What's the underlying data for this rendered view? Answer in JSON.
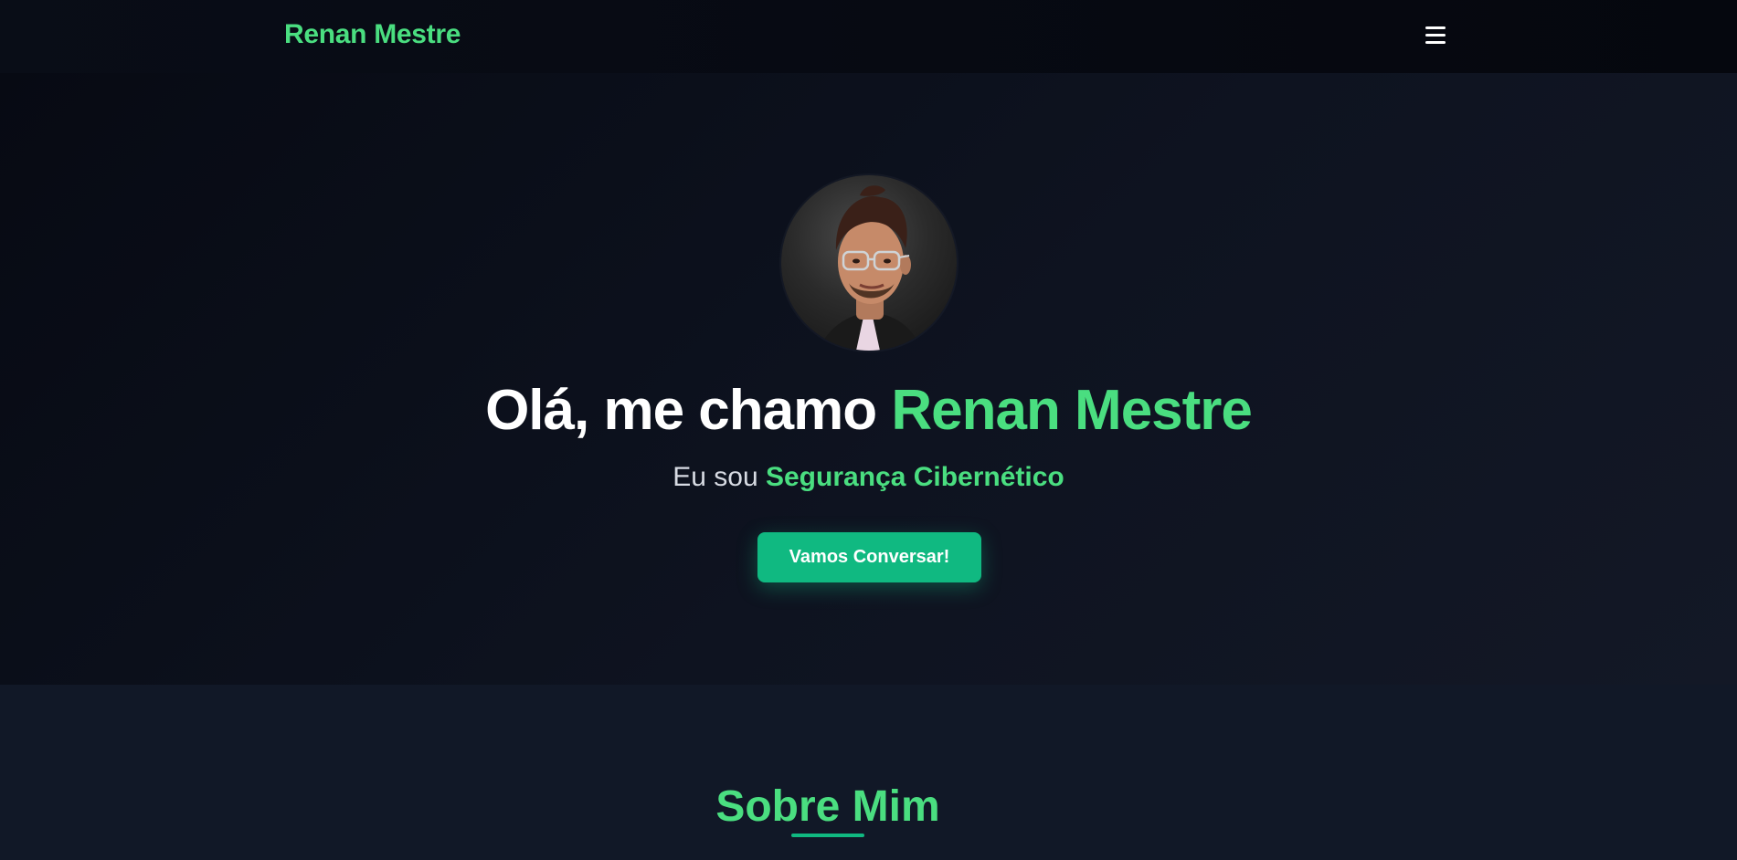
{
  "navbar": {
    "brand": "Renan Mestre",
    "menu_icon": "hamburger-menu-icon"
  },
  "hero": {
    "avatar_alt": "profile photo",
    "headline_prefix": "Olá, me chamo ",
    "headline_name": "Renan Mestre",
    "subline_prefix": "Eu sou ",
    "subline_role": "Segurança Cibernético",
    "cta_label": "Vamos Conversar!"
  },
  "about": {
    "title": "Sobre Mim"
  },
  "colors": {
    "accent": "#4ade80",
    "button": "#10b981",
    "background": "#0b0f19",
    "section_bg": "#111827"
  }
}
